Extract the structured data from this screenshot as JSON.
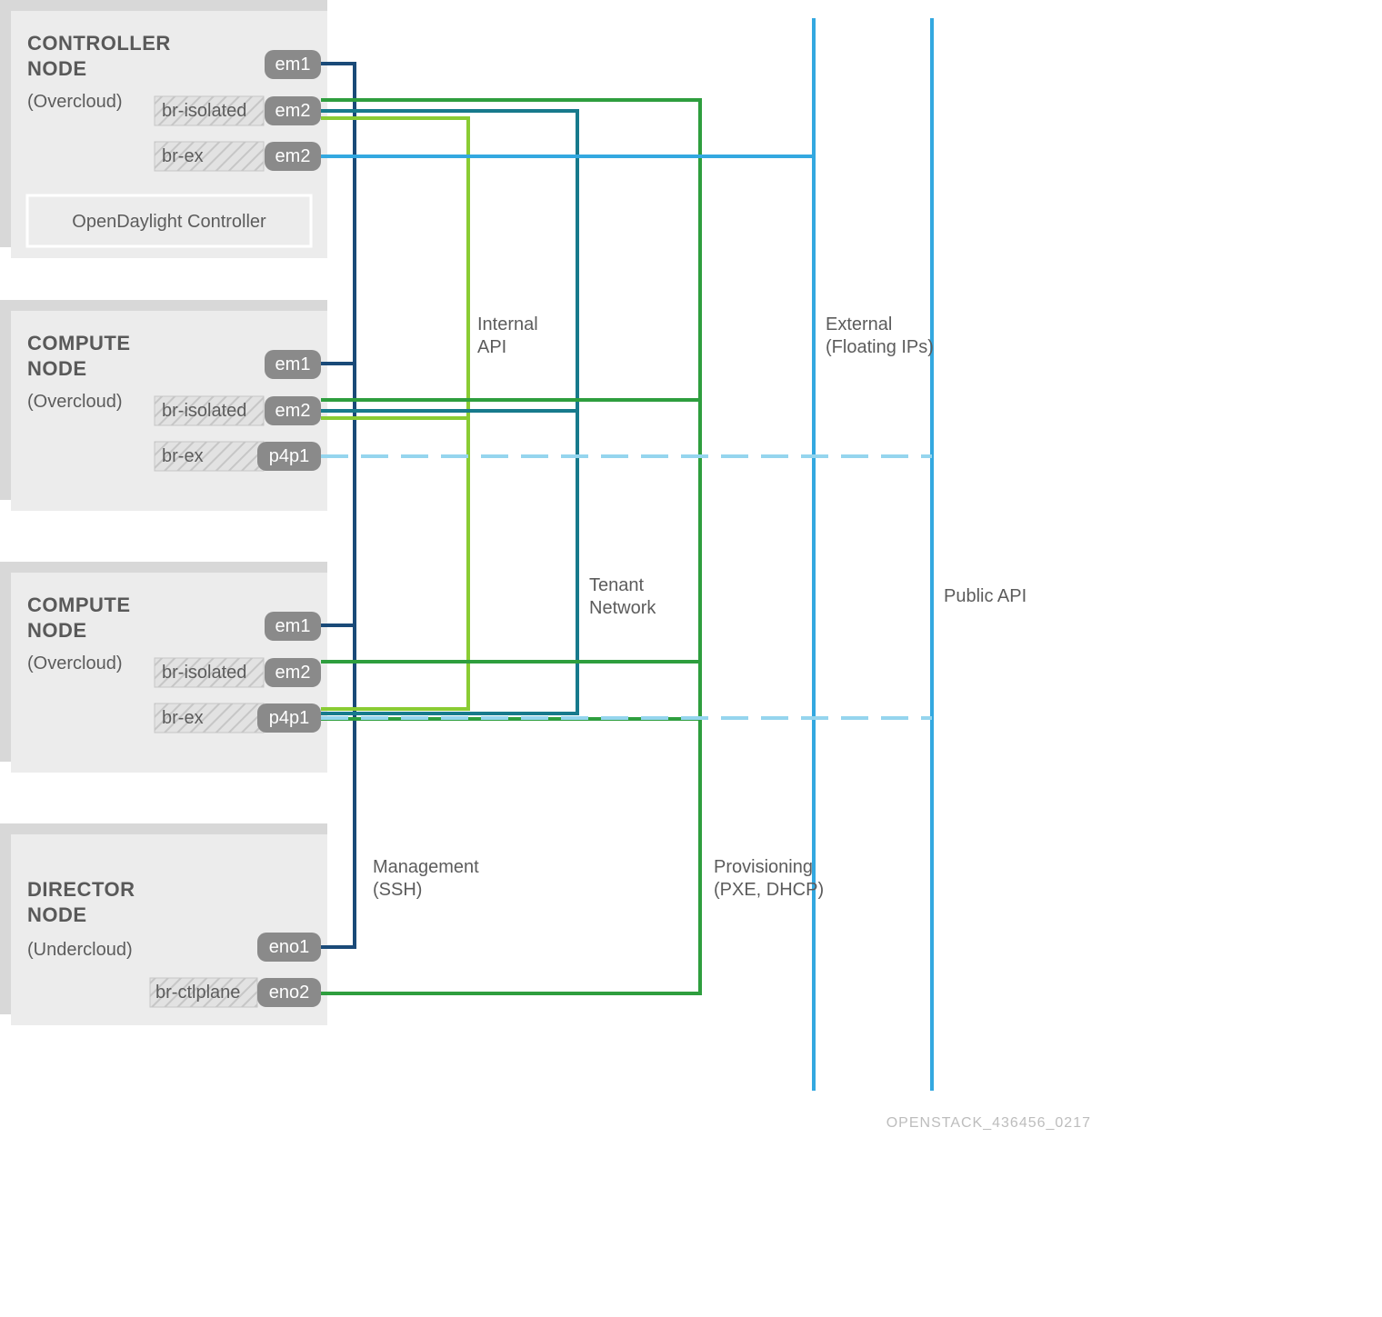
{
  "nodes": [
    {
      "title": "CONTROLLER NODE",
      "sub": "(Overcloud)",
      "bridges": [
        {
          "bridge": "",
          "iface": "em1"
        },
        {
          "bridge": "br-isolated",
          "iface": "em2"
        },
        {
          "bridge": "br-ex",
          "iface": "em2"
        }
      ],
      "odl": "OpenDaylight Controller"
    },
    {
      "title": "COMPUTE NODE",
      "sub": "(Overcloud)",
      "bridges": [
        {
          "bridge": "",
          "iface": "em1"
        },
        {
          "bridge": "br-isolated",
          "iface": "em2"
        },
        {
          "bridge": "br-ex",
          "iface": "p4p1"
        }
      ]
    },
    {
      "title": "COMPUTE NODE",
      "sub": "(Overcloud)",
      "bridges": [
        {
          "bridge": "",
          "iface": "em1"
        },
        {
          "bridge": "br-isolated",
          "iface": "em2"
        },
        {
          "bridge": "br-ex",
          "iface": "p4p1"
        }
      ]
    },
    {
      "title": "DIRECTOR NODE",
      "sub": "(Undercloud)",
      "bridges": [
        {
          "bridge": "",
          "iface": "eno1"
        },
        {
          "bridge": "br-ctlplane",
          "iface": "eno2"
        }
      ]
    }
  ],
  "networks": {
    "management": {
      "label1": "Management",
      "label2": "(SSH)"
    },
    "internal_api": {
      "label1": "Internal",
      "label2": "API"
    },
    "tenant": {
      "label1": "Tenant",
      "label2": "Network"
    },
    "provisioning": {
      "label1": "Provisioning",
      "label2": "(PXE, DHCP)"
    },
    "external": {
      "label1": "External",
      "label2": "(Floating IPs)"
    },
    "public_api": {
      "label1": "Public API"
    }
  },
  "footer": "OPENSTACK_436456_0217"
}
